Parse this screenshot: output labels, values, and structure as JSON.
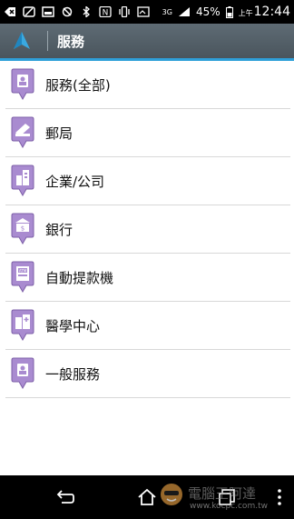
{
  "status_bar": {
    "battery_percent": "45%",
    "am_pm": "上午",
    "time": "12:44",
    "network": "3G",
    "network_sub": "H"
  },
  "action_bar": {
    "title": "服務"
  },
  "list": {
    "items": [
      {
        "label": "服務(全部)",
        "icon": "service-all-icon"
      },
      {
        "label": "郵局",
        "icon": "post-office-icon"
      },
      {
        "label": "企業/公司",
        "icon": "company-icon"
      },
      {
        "label": "銀行",
        "icon": "bank-icon"
      },
      {
        "label": "自動提款機",
        "icon": "atm-icon"
      },
      {
        "label": "醫學中心",
        "icon": "hospital-icon"
      },
      {
        "label": "一般服務",
        "icon": "general-service-icon"
      }
    ]
  },
  "watermark": {
    "text": "電腦王阿達",
    "url": "www.kocpc.com.tw"
  },
  "colors": {
    "pin_purple": "#a98bd0",
    "accent_blue": "#2e9fd8",
    "action_bar": "#56626b"
  }
}
